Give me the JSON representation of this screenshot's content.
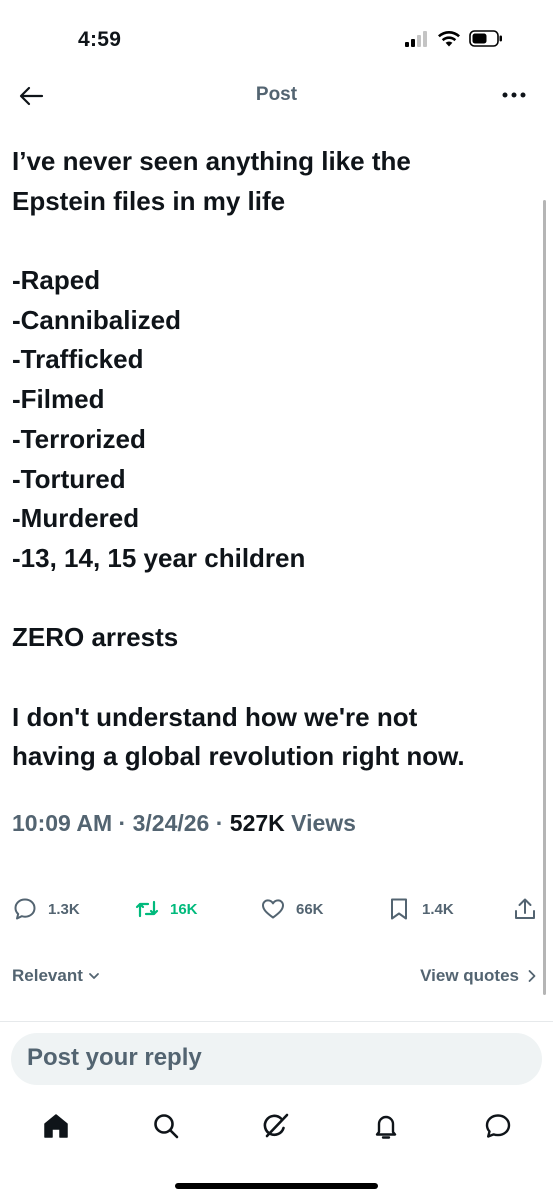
{
  "status_bar": {
    "time": "4:59",
    "icons": [
      "cellular-signal-icon",
      "wifi-icon",
      "battery-icon"
    ]
  },
  "header": {
    "title": "Post",
    "back_icon": "back-arrow-icon",
    "more_icon": "more-options-icon"
  },
  "post": {
    "lines": [
      "I’ve never seen anything like the",
      "Epstein files in my life",
      "",
      "-Raped",
      "-Cannibalized",
      "-Trafficked",
      "-Filmed",
      "-Terrorized",
      "-Tortured",
      "-Murdered",
      "-13, 14, 15 year children",
      "",
      "ZERO arrests",
      "",
      "I don't understand how we're not",
      "having a global revolution right now."
    ],
    "time": "10:09 AM",
    "date": "3/24/26",
    "views_count": "527K",
    "views_label": "Views",
    "separator": "·"
  },
  "actions": {
    "replies": "1.3K",
    "reposts": "16K",
    "likes": "66K",
    "bookmarks": "1.4K",
    "repost_color": "#00ba7c"
  },
  "replies_section": {
    "sort_label": "Relevant",
    "quotes_link": "View quotes",
    "reply_placeholder": "Post your reply"
  },
  "bottom_nav": {
    "items": [
      "home-icon",
      "search-icon",
      "grok-icon",
      "notifications-icon",
      "messages-icon"
    ],
    "active": "home-icon"
  },
  "colors": {
    "text_primary": "#0f1419",
    "text_secondary": "#536471",
    "reply_box_bg": "#eff3f4"
  }
}
